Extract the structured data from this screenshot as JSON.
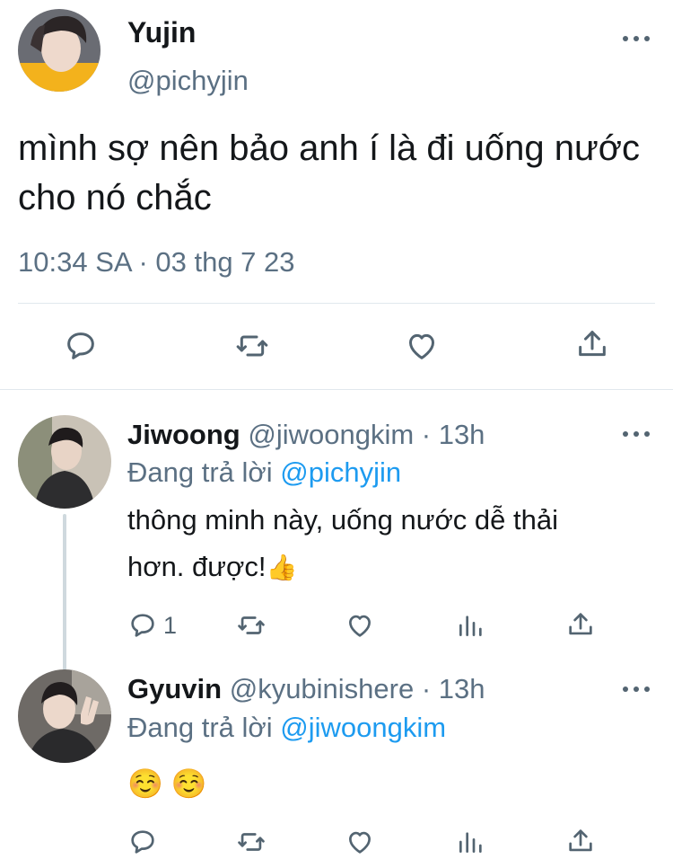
{
  "main_tweet": {
    "display_name": "Yujin",
    "handle": "@pichyjin",
    "text": "mình sợ nên bảo anh í là đi uống nước cho nó chắc",
    "timestamp": "10:34 SA · 03 thg 7 23",
    "actions": [
      "reply-icon",
      "retweet-icon",
      "like-icon",
      "share-icon"
    ]
  },
  "replies": [
    {
      "display_name": "Jiwoong",
      "handle_time": "@jiwoongkim · 13h",
      "replying_prefix": "Đang trả lời ",
      "replying_to": "@pichyjin",
      "text_line1": "thông minh này, uống nước dễ thải",
      "text_line2": "hơn. được!",
      "emoji": "👍",
      "reply_count": "1"
    },
    {
      "display_name": "Gyuvin",
      "handle_time": "@kyubinishere · 13h",
      "replying_prefix": "Đang trả lời ",
      "replying_to": "@jiwoongkim",
      "text": "☺️ ☺️"
    }
  ],
  "colors": {
    "accent": "#1d9bf0",
    "secondary_text": "#5b7083",
    "divider": "#e1e8ed",
    "thread_line": "#cfd9de"
  }
}
